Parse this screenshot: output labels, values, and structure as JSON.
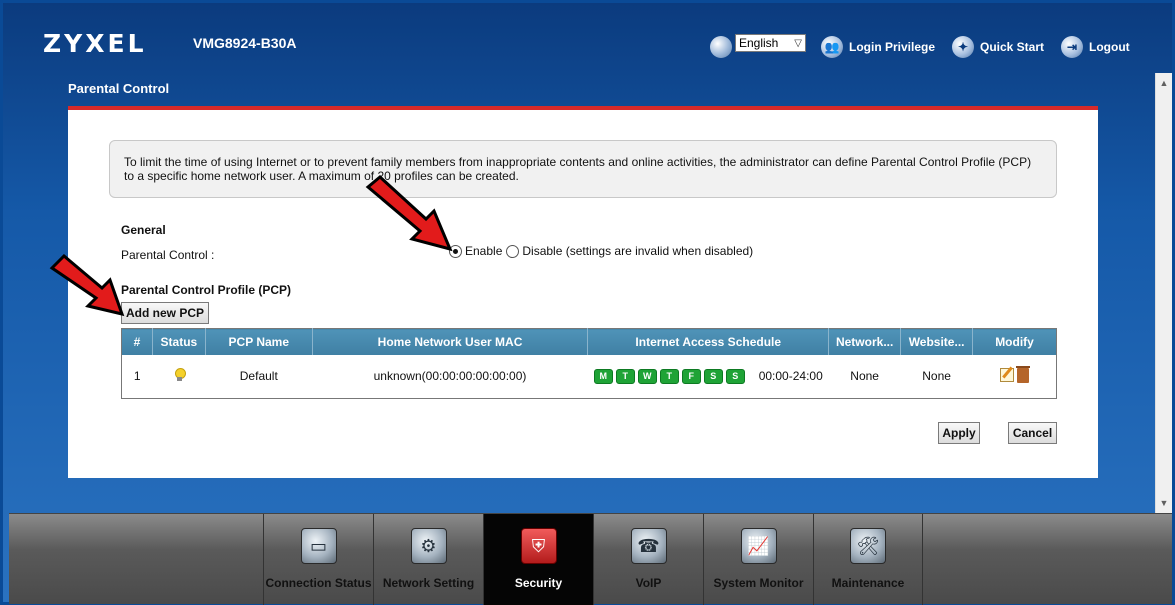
{
  "header": {
    "brand": "ZYXEL",
    "model": "VMG8924-B30A",
    "language": "English",
    "login_privilege": "Login Privilege",
    "quick_start": "Quick Start",
    "logout": "Logout"
  },
  "page": {
    "title": "Parental Control",
    "info": "To limit the time of using Internet or to prevent family members from inappropriate contents and online activities, the administrator can define Parental Control Profile (PCP) to a specific home network user. A maximum of 20 profiles can be created."
  },
  "general": {
    "heading": "General",
    "parental_control_label": "Parental Control :",
    "enable_label": "Enable",
    "disable_label": "Disable (settings are invalid when disabled)",
    "selected": "Enable"
  },
  "pcp": {
    "heading": "Parental Control Profile (PCP)",
    "add_button": "Add new PCP",
    "columns": [
      "#",
      "Status",
      "PCP Name",
      "Home Network User MAC",
      "Internet Access Schedule",
      "Network...",
      "Website...",
      "Modify"
    ],
    "rows": [
      {
        "num": "1",
        "status": "on",
        "name": "Default",
        "mac": "unknown(00:00:00:00:00:00)",
        "days": [
          "M",
          "T",
          "W",
          "T",
          "F",
          "S",
          "S"
        ],
        "time": "00:00-24:00",
        "network": "None",
        "website": "None"
      }
    ]
  },
  "actions": {
    "apply": "Apply",
    "cancel": "Cancel"
  },
  "nav": {
    "items": [
      {
        "label": "Connection Status",
        "icon": "monitor-icon"
      },
      {
        "label": "Network Setting",
        "icon": "gear-icon"
      },
      {
        "label": "Security",
        "icon": "shield-icon",
        "active": true
      },
      {
        "label": "VoIP",
        "icon": "phone-icon"
      },
      {
        "label": "System Monitor",
        "icon": "chart-monitor-icon"
      },
      {
        "label": "Maintenance",
        "icon": "tools-icon"
      }
    ]
  },
  "colors": {
    "accent_red": "#d62a2a",
    "header_blue": "#0b3b7e",
    "table_header": "#4f93b8",
    "day_green": "#1fa336"
  }
}
